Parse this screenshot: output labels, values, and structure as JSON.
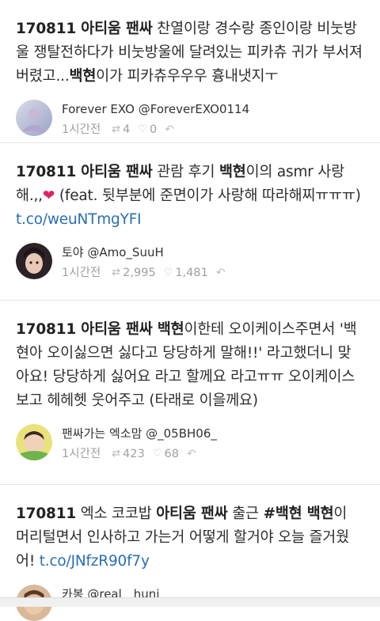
{
  "tweets": [
    {
      "segments": [
        {
          "t": "170811 아티움 팬싸",
          "style": "bold"
        },
        {
          "t": " 찬열이랑 경수랑 종인이랑 비눗방울 쟁탈전하다가 비눗방울에 달려있는 피카츄 귀가 부서져버렸고...",
          "style": "normal"
        },
        {
          "t": "백현",
          "style": "bold"
        },
        {
          "t": "이가 피카츄우우우 흉내냇지ㅜ",
          "style": "normal"
        }
      ],
      "user": "Forever EXO @ForeverEXO0114",
      "time": "1시간전",
      "retweets": "4",
      "favorites": "0"
    },
    {
      "segments": [
        {
          "t": "170811 아티움 팬싸",
          "style": "bold"
        },
        {
          "t": " 관람 후기 ",
          "style": "normal"
        },
        {
          "t": "백현",
          "style": "bold"
        },
        {
          "t": "이의 asmr 사랑해.,,",
          "style": "normal"
        },
        {
          "t": "❤",
          "style": "heart"
        },
        {
          "t": " (feat. 뒷부분에 준면이가 사랑해 따라해찌ㅠㅠㅠ) ",
          "style": "normal"
        },
        {
          "t": "t.co/weuNTmgYFI",
          "style": "link"
        }
      ],
      "user": "토야 @Amo_SuuH",
      "time": "1시간전",
      "retweets": "2,995",
      "favorites": "1,481"
    },
    {
      "segments": [
        {
          "t": "170811 아티움 팬싸 백현",
          "style": "bold"
        },
        {
          "t": "이한테 오이케이스주면서 '백현아 오이싫으면 싫다고 당당하게 말해!!' 라고했더니 맞아요! 당당하게 싫어요 라고 할께요 라고ㅠㅠ 오이케이스 보고 헤헤헷 웃어주고 (타래로 이을께요)",
          "style": "normal"
        }
      ],
      "user": "팬싸가는 엑소맘 @_05BH06_",
      "time": "1시간전",
      "retweets": "423",
      "favorites": "68"
    },
    {
      "segments": [
        {
          "t": "170811",
          "style": "bold"
        },
        {
          "t": " 엑소 코코밥 ",
          "style": "normal"
        },
        {
          "t": "아티움 팬싸",
          "style": "bold"
        },
        {
          "t": " 출근 ",
          "style": "normal"
        },
        {
          "t": "#백현 백현",
          "style": "bold"
        },
        {
          "t": "이 머리털면서 인사하고 가는거 어떻게 할거야 오늘 즐거웠어! ",
          "style": "normal"
        },
        {
          "t": "t.co/JNfzR90f7y",
          "style": "link"
        }
      ],
      "user": "카봉 @real__huni",
      "time": "",
      "retweets": "",
      "favorites": ""
    }
  ],
  "icons": {
    "retweet": "retweet-icon",
    "favorite": "heart-outline-icon",
    "reply": "reply-icon"
  },
  "colors": {
    "link": "#2a6fb3",
    "heart": "#e0245e",
    "meta_gray": "#a0a0a0"
  }
}
